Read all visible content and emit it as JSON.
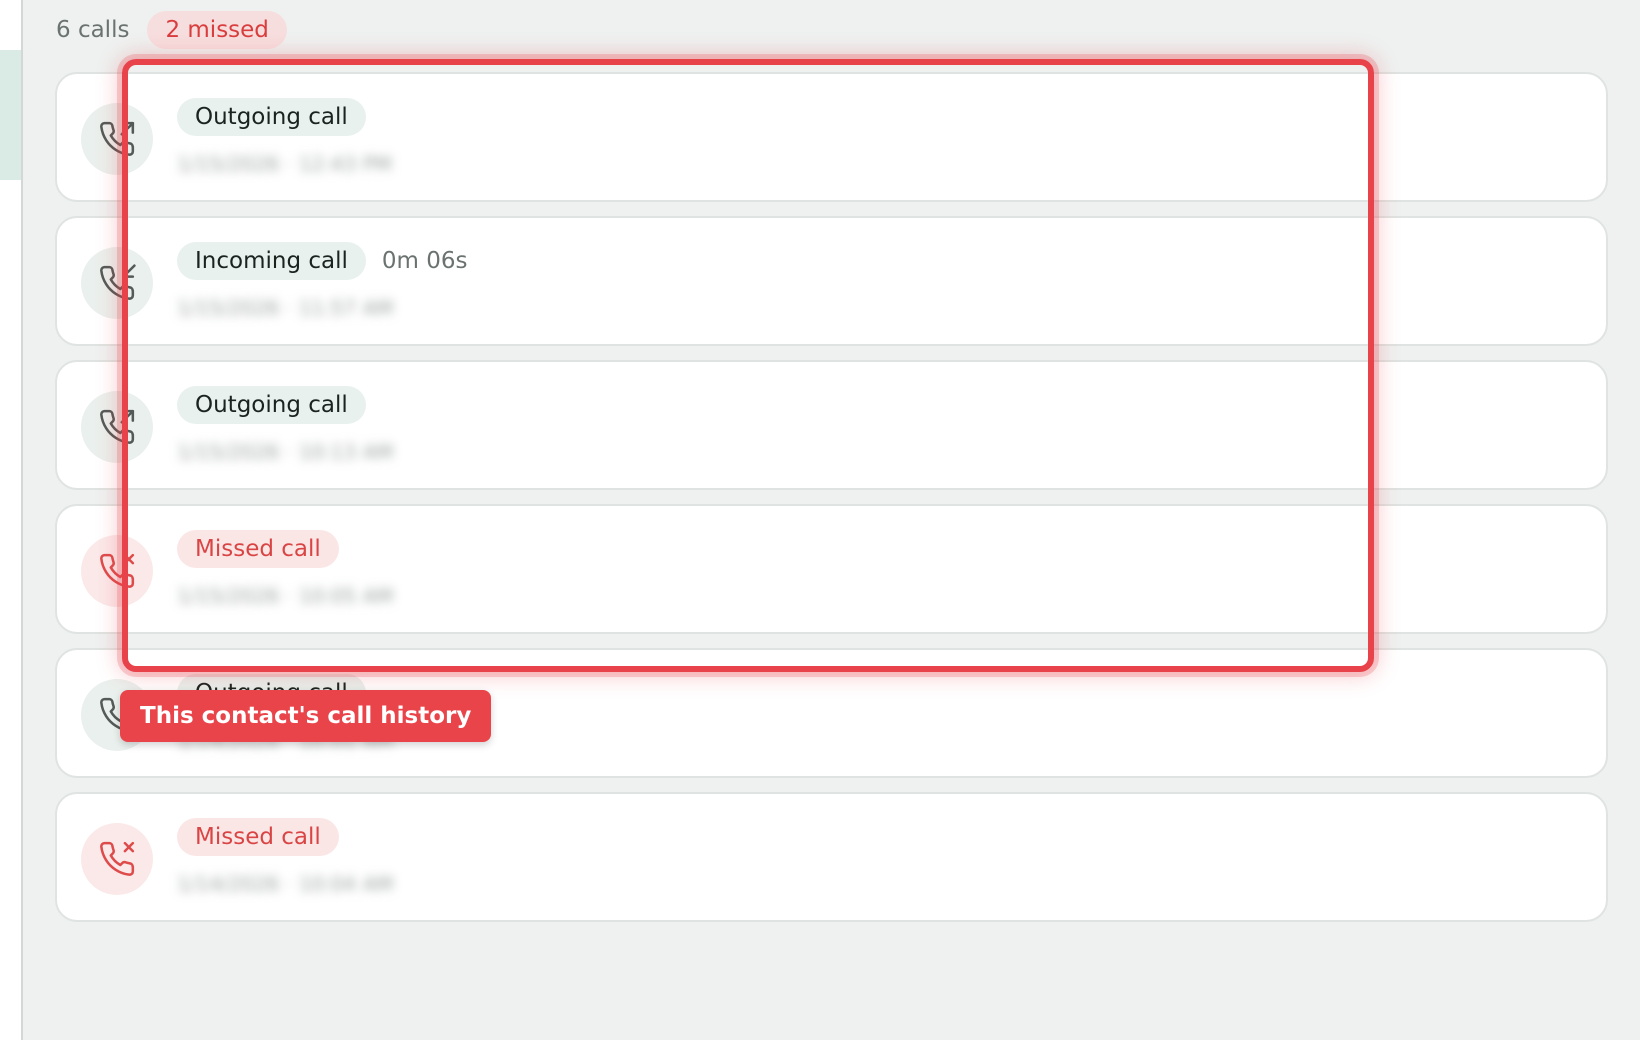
{
  "summary": {
    "count_label": "6 calls",
    "missed_label": "2 missed"
  },
  "calls": [
    {
      "type_label": "Outgoing call",
      "duration": "",
      "timestamp": "1/15/2026 · 12:43 PM",
      "kind": "outgoing",
      "icon": "phone-outgoing-icon"
    },
    {
      "type_label": "Incoming call",
      "duration": "0m 06s",
      "timestamp": "1/15/2026 · 11:57 AM",
      "kind": "incoming",
      "icon": "phone-incoming-icon"
    },
    {
      "type_label": "Outgoing call",
      "duration": "",
      "timestamp": "1/15/2026 · 10:13 AM",
      "kind": "outgoing",
      "icon": "phone-outgoing-icon"
    },
    {
      "type_label": "Missed call",
      "duration": "",
      "timestamp": "1/15/2026 · 10:05 AM",
      "kind": "missed",
      "icon": "phone-missed-icon"
    },
    {
      "type_label": "Outgoing call",
      "duration": "",
      "timestamp": "1/14/2026 · 10:01 AM",
      "kind": "outgoing",
      "icon": "phone-outgoing-icon"
    },
    {
      "type_label": "Missed call",
      "duration": "",
      "timestamp": "1/14/2026 · 10:04 AM",
      "kind": "missed",
      "icon": "phone-missed-icon"
    }
  ],
  "tour": {
    "tooltip_text": "This contact's call history"
  },
  "colors": {
    "accent_red": "#e8424a",
    "missed_text": "#d94545",
    "page_bg": "#eef1f0"
  }
}
